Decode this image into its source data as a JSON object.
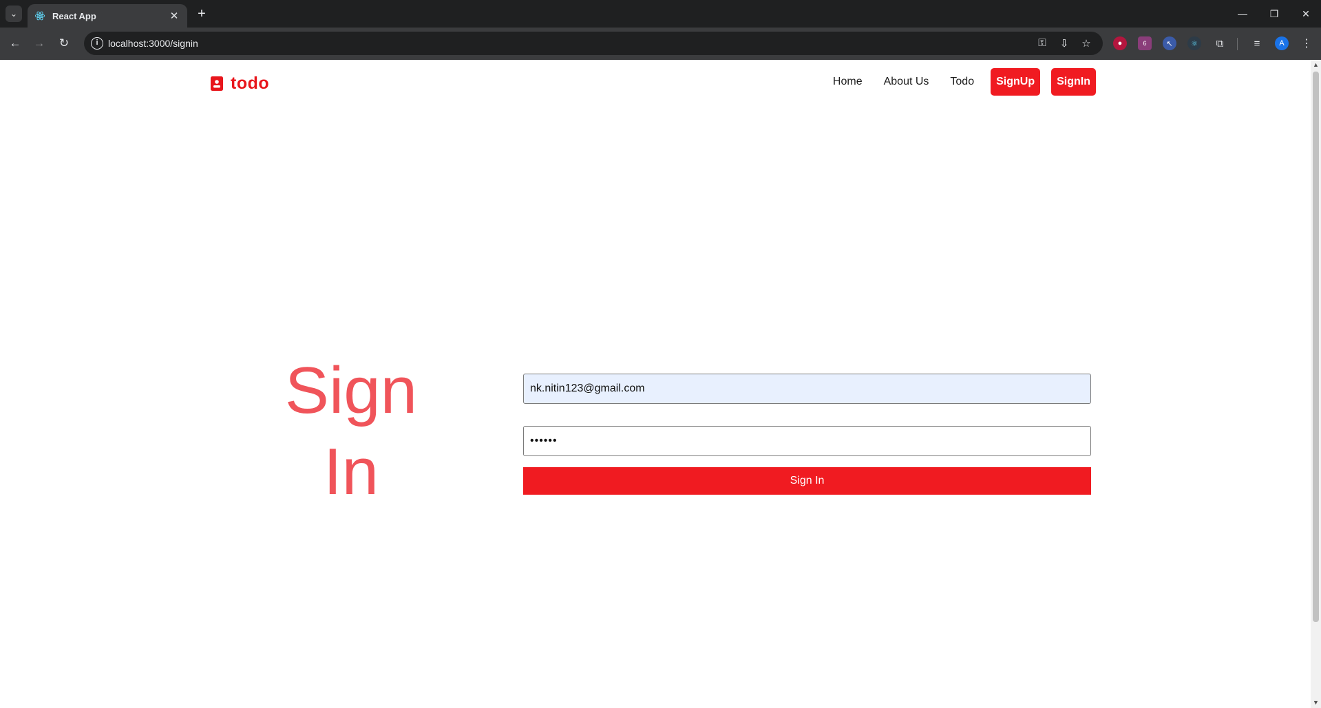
{
  "browser": {
    "tab_title": "React App",
    "url": "localhost:3000/signin",
    "profile_initial": "A",
    "extension_badge": "6"
  },
  "navbar": {
    "brand": "todo",
    "links": [
      "Home",
      "About Us",
      "Todo"
    ],
    "signup_label": "SignUp",
    "signin_label": "SignIn"
  },
  "main": {
    "heading_line1": "Sign",
    "heading_line2": "In",
    "email_value": "nk.nitin123@gmail.com",
    "password_value": "••••••",
    "submit_label": "Sign In"
  },
  "colors": {
    "brand_red": "#f01b21",
    "heading_red": "#f0545a",
    "autofill_blue": "#e8f0fe"
  }
}
